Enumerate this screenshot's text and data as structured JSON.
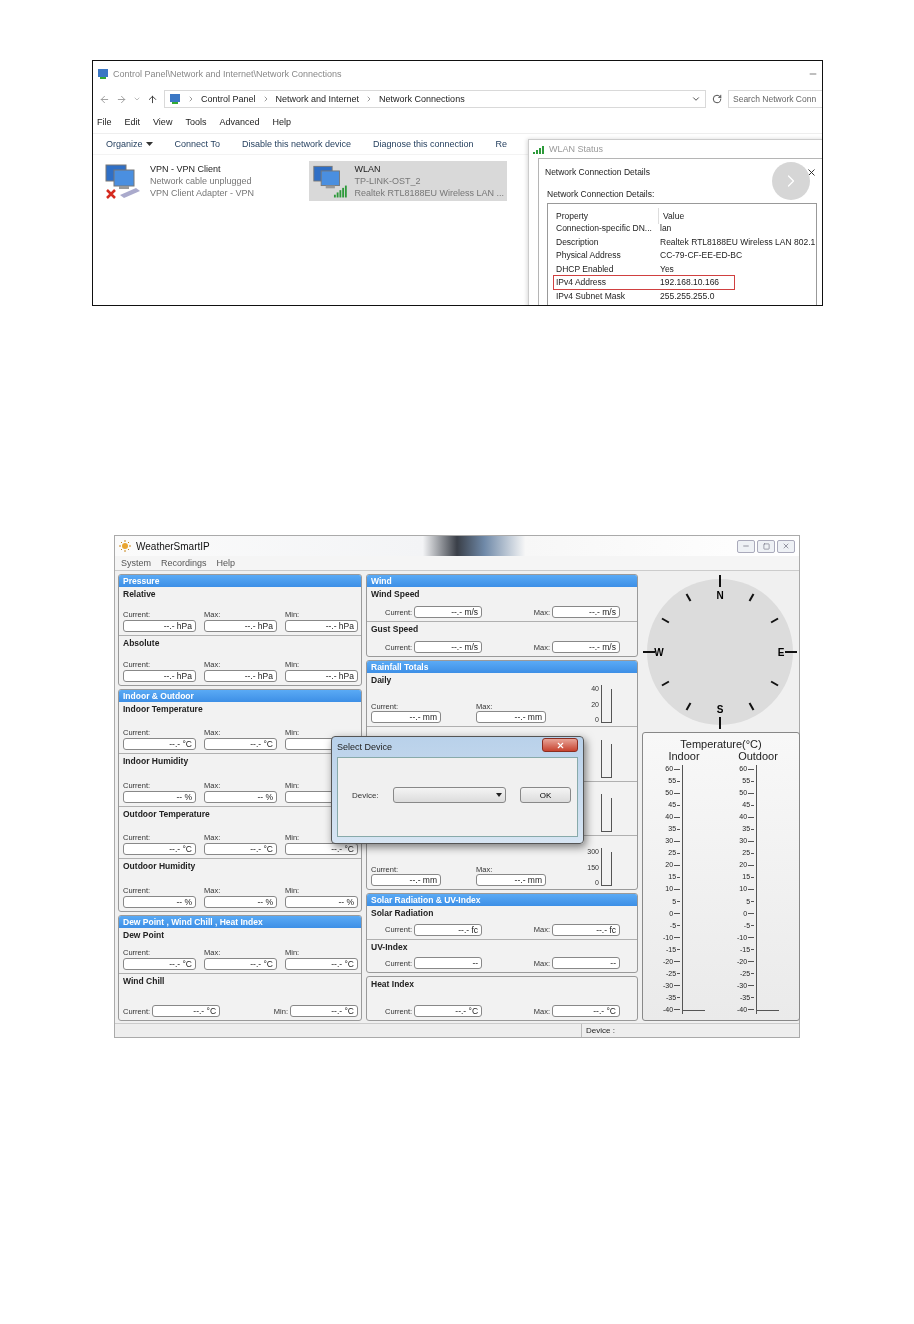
{
  "explorer": {
    "title": "Control Panel\\Network and Internet\\Network Connections",
    "breadcrumb": [
      "Control Panel",
      "Network and Internet",
      "Network Connections"
    ],
    "search": {
      "placeholder": "Search Network Conn"
    },
    "menu": [
      "File",
      "Edit",
      "View",
      "Tools",
      "Advanced",
      "Help"
    ],
    "toolbar": [
      {
        "label": "Organize",
        "kind": "dropdown"
      },
      {
        "label": "Connect To",
        "kind": "plain"
      },
      {
        "label": "Disable this network device",
        "kind": "plain"
      },
      {
        "label": "Diagnose this connection",
        "kind": "plain"
      },
      {
        "label": "Re",
        "kind": "plain"
      }
    ],
    "connections": [
      {
        "name": "VPN - VPN Client",
        "status": "Network cable unplugged",
        "adapter": "VPN Client Adapter - VPN",
        "kind": "unplugged",
        "selected": false
      },
      {
        "name": "WLAN",
        "status": "TP-LINK-OST_2",
        "adapter": "Realtek RTL8188EU Wireless LAN ...",
        "kind": "wireless",
        "selected": true
      }
    ]
  },
  "wlan_status": {
    "title": "WLAN Status"
  },
  "details": {
    "title": "Network Connection Details",
    "caption": "Network Connection Details:",
    "columns": [
      "Property",
      "Value"
    ],
    "rows": [
      {
        "property": "Connection-specific DN...",
        "value": "lan",
        "highlighted": false
      },
      {
        "property": "Description",
        "value": "Realtek RTL8188EU Wireless LAN 802.1",
        "highlighted": false
      },
      {
        "property": "Physical Address",
        "value": "CC-79-CF-EE-ED-BC",
        "highlighted": false
      },
      {
        "property": "DHCP Enabled",
        "value": "Yes",
        "highlighted": false
      },
      {
        "property": "IPv4 Address",
        "value": "192.168.10.166",
        "highlighted": true
      },
      {
        "property": "IPv4 Subnet Mask",
        "value": "255.255.255.0",
        "highlighted": false
      }
    ]
  },
  "weather": {
    "title": "WeatherSmartIP",
    "menu": [
      "System",
      "Recordings",
      "Help"
    ],
    "left_groups": [
      {
        "title": "Pressure",
        "sections": [
          {
            "label": "Relative",
            "kind": "stacked",
            "fields": [
              {
                "label": "Current:",
                "value": "--.- hPa"
              },
              {
                "label": "Max:",
                "value": "--.- hPa"
              },
              {
                "label": "Min:",
                "value": "--.- hPa"
              }
            ]
          },
          {
            "label": "Absolute",
            "kind": "stacked",
            "fields": [
              {
                "label": "Current:",
                "value": "--.- hPa"
              },
              {
                "label": "Max:",
                "value": "--.- hPa"
              },
              {
                "label": "Min:",
                "value": "--.- hPa"
              }
            ]
          }
        ]
      },
      {
        "title": "Indoor & Outdoor",
        "sections": [
          {
            "label": "Indoor Temperature",
            "kind": "stacked",
            "fields": [
              {
                "label": "Current:",
                "value": "--.- °C"
              },
              {
                "label": "Max:",
                "value": "--.- °C"
              },
              {
                "label": "Min:"
              }
            ]
          },
          {
            "label": "Indoor Humidity",
            "kind": "stacked",
            "fields": [
              {
                "label": "Current:",
                "value": "-- %"
              },
              {
                "label": "Max:",
                "value": "-- %"
              },
              {
                "label": "Min:"
              }
            ]
          },
          {
            "label": "Outdoor Temperature",
            "kind": "stacked",
            "fields": [
              {
                "label": "Current:",
                "value": "--.- °C"
              },
              {
                "label": "Max:",
                "value": "--.- °C"
              },
              {
                "label": "Min:",
                "value": "--.- °C"
              }
            ]
          },
          {
            "label": "Outdoor Humidity",
            "kind": "stacked",
            "fields": [
              {
                "label": "Current:",
                "value": "-- %"
              },
              {
                "label": "Max:",
                "value": "-- %"
              },
              {
                "label": "Min:",
                "value": "-- %"
              }
            ]
          }
        ]
      },
      {
        "title": "Dew Point , Wind Chill , Heat Index",
        "sections": [
          {
            "label": "Dew Point",
            "kind": "stacked",
            "fields": [
              {
                "label": "Current:",
                "value": "--.- °C"
              },
              {
                "label": "Max:",
                "value": "--.- °C"
              },
              {
                "label": "Min:",
                "value": "--.- °C"
              }
            ]
          },
          {
            "label": "Wind Chill",
            "kind": "inline",
            "fields": [
              {
                "label": "Current:",
                "value": "--.- °C"
              },
              {
                "label": "Min:",
                "value": "--.- °C"
              }
            ]
          }
        ]
      }
    ],
    "middle_groups": [
      {
        "title": "Wind",
        "sections": [
          {
            "label": "Wind Speed",
            "kind": "inline",
            "fields": [
              {
                "label": "Current:",
                "value": "--.- m/s"
              },
              {
                "label": "Max:",
                "value": "--.- m/s"
              }
            ]
          },
          {
            "label": "Gust Speed",
            "kind": "inline",
            "fields": [
              {
                "label": "Current:",
                "value": "--.- m/s"
              },
              {
                "label": "Max:",
                "value": "--.- m/s"
              }
            ]
          }
        ]
      },
      {
        "title": "Rainfall Totals",
        "sections": [
          {
            "label": "Daily",
            "kind": "rain",
            "fields": [
              {
                "label": "Current:",
                "value": "--.- mm"
              },
              {
                "label": "Max:",
                "value": "--.- mm"
              }
            ],
            "scale": [
              "40",
              "20",
              "0"
            ]
          },
          {
            "kind": "covered"
          },
          {
            "kind": "covered"
          },
          {
            "kind": "rain",
            "fields": [
              {
                "label": "Current:",
                "value": "--.- mm"
              },
              {
                "label": "Max:",
                "value": "--.- mm"
              }
            ],
            "scale": [
              "300",
              "150",
              "0"
            ]
          }
        ]
      },
      {
        "title": "Solar Radiation & UV-Index",
        "sections": [
          {
            "label": "Solar Radiation",
            "kind": "inline",
            "fields": [
              {
                "label": "Current:",
                "value": "--.- fc"
              },
              {
                "label": "Max:",
                "value": "--.- fc"
              }
            ]
          },
          {
            "label": "UV-Index",
            "kind": "inline",
            "fields": [
              {
                "label": "Current:",
                "value": "--"
              },
              {
                "label": "Max:",
                "value": "--"
              }
            ]
          }
        ]
      },
      {
        "sections": [
          {
            "label": "Heat Index",
            "kind": "inline",
            "fields": [
              {
                "label": "Current:",
                "value": "--.- °C"
              },
              {
                "label": "Max:",
                "value": "--.- °C"
              }
            ]
          }
        ]
      }
    ],
    "compass": {
      "north": "N",
      "east": "E",
      "south": "S",
      "west": "W"
    },
    "temperature": {
      "title": "Temperature(°C)",
      "columns": [
        {
          "label": "Indoor",
          "scale": [
            "60",
            "55",
            "50",
            "45",
            "40",
            "35",
            "30",
            "25",
            "20",
            "15",
            "10",
            "5",
            "0",
            "-5",
            "-10",
            "-15",
            "-20",
            "-25",
            "-30",
            "-35",
            "-40"
          ]
        },
        {
          "label": "Outdoor",
          "scale": [
            "60",
            "55",
            "50",
            "45",
            "40",
            "35",
            "30",
            "25",
            "20",
            "15",
            "10",
            "5",
            "0",
            "-5",
            "-10",
            "-15",
            "-20",
            "-25",
            "-30",
            "-35",
            "-40"
          ]
        }
      ]
    },
    "status_bar": {
      "device_label": "Device :"
    },
    "dialog": {
      "title": "Select Device",
      "label": "Device:",
      "button": "OK"
    }
  }
}
